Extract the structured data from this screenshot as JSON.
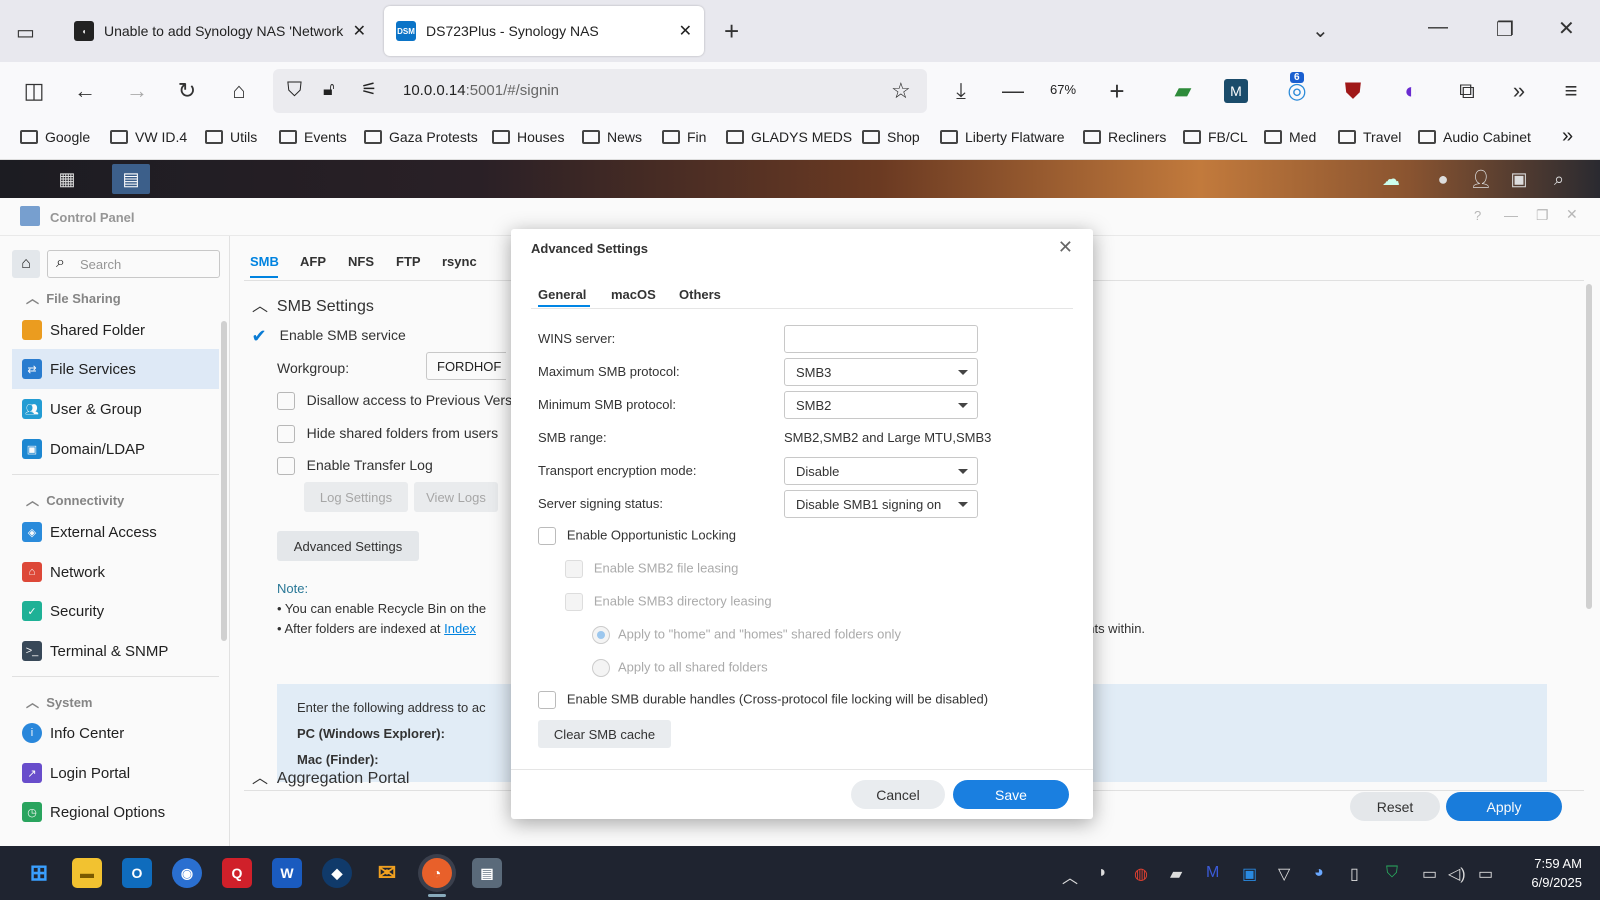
{
  "browser": {
    "tabs": [
      {
        "title": "Unable to add Synology NAS 'Network",
        "active": false
      },
      {
        "title": "DS723Plus - Synology NAS",
        "active": true
      }
    ],
    "url_host": "10.0.0.14",
    "url_rest": ":5001/#/signin",
    "zoom": "67%",
    "extension_badge": "6",
    "bookmarks": [
      "Google",
      "VW ID.4",
      "Utils",
      "Events",
      "Gaza Protests",
      "Houses",
      "News",
      "Fin",
      "GLADYS MEDS",
      "Shop",
      "Liberty Flatware",
      "Recliners",
      "FB/CL",
      "Med",
      "Travel",
      "Audio Cabinet"
    ]
  },
  "control_panel": {
    "title": "Control Panel",
    "search_placeholder": "Search",
    "sections": {
      "file_sharing": "File Sharing",
      "connectivity": "Connectivity",
      "system": "System"
    },
    "items": {
      "shared_folder": "Shared Folder",
      "file_services": "File Services",
      "user_group": "User & Group",
      "domain_ldap": "Domain/LDAP",
      "external_access": "External Access",
      "network": "Network",
      "security": "Security",
      "terminal_snmp": "Terminal & SNMP",
      "info_center": "Info Center",
      "login_portal": "Login Portal",
      "regional_options": "Regional Options"
    },
    "tabs": [
      "SMB",
      "AFP",
      "NFS",
      "FTP",
      "rsync"
    ],
    "smb_settings_title": "SMB Settings",
    "enable_smb": "Enable SMB service",
    "workgroup_label": "Workgroup:",
    "workgroup_value": "FORDHOF",
    "disallow_prev": "Disallow access to Previous Vers",
    "hide_shared": "Hide shared folders from users",
    "enable_transfer_log": "Enable Transfer Log",
    "log_settings": "Log Settings",
    "view_logs": "View Logs",
    "advanced_settings_btn": "Advanced Settings",
    "note_label": "Note:",
    "note_1": "• You can enable Recycle Bin on the",
    "note_2_pre": "• After folders are indexed at",
    "note_2_link": "Index",
    "note_2_tail": "ents within.",
    "info_text": "Enter the following address to ac",
    "pc_label": "PC (Windows Explorer):",
    "mac_label": "Mac (Finder):",
    "aggregation_portal": "Aggregation Portal",
    "reset": "Reset",
    "apply": "Apply"
  },
  "dialog": {
    "title": "Advanced Settings",
    "tabs": [
      "General",
      "macOS",
      "Others"
    ],
    "wins_label": "WINS server:",
    "wins_value": "",
    "max_proto_label": "Maximum SMB protocol:",
    "max_proto_value": "SMB3",
    "min_proto_label": "Minimum SMB protocol:",
    "min_proto_value": "SMB2",
    "range_label": "SMB range:",
    "range_value": "SMB2,SMB2 and Large MTU,SMB3",
    "encrypt_label": "Transport encryption mode:",
    "encrypt_value": "Disable",
    "signing_label": "Server signing status:",
    "signing_value": "Disable SMB1 signing on",
    "oplock": "Enable Opportunistic Locking",
    "smb2_leasing": "Enable SMB2 file leasing",
    "smb3_dir_leasing": "Enable SMB3 directory leasing",
    "apply_home": "Apply to \"home\" and \"homes\" shared folders only",
    "apply_all": "Apply to all shared folders",
    "durable": "Enable SMB durable handles (Cross-protocol file locking will be disabled)",
    "clear_cache": "Clear SMB cache",
    "cancel": "Cancel",
    "save": "Save"
  },
  "taskbar": {
    "time": "7:59 AM",
    "date": "6/9/2025"
  },
  "colors": {
    "accent": "#0086e5",
    "primary_button": "#1a7fe0",
    "active_sidebar": "#e3eefb"
  }
}
